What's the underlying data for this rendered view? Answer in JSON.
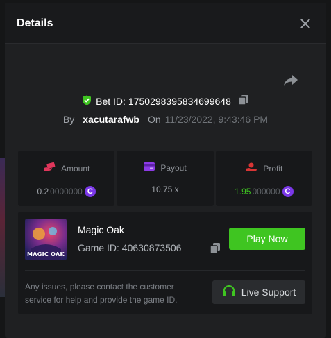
{
  "modal": {
    "title": "Details"
  },
  "bet": {
    "id_label": "Bet ID:",
    "id_value": "1750298395834699648",
    "by_label": "By",
    "username": "xacutarafwb",
    "on_label": "On",
    "date": "11/23/2022, 9:43:46 PM"
  },
  "stats": {
    "amount": {
      "label": "Amount",
      "value_main": "0.2",
      "value_dim": "0000000",
      "currency": "C"
    },
    "payout": {
      "label": "Payout",
      "value": "10.75 x"
    },
    "profit": {
      "label": "Profit",
      "value_main": "1.95",
      "value_dim": "000000",
      "currency": "C"
    }
  },
  "game": {
    "thumb_text": "MAGIC OAK",
    "name": "Magic Oak",
    "id_label": "Game ID: 40630873506",
    "play_label": "Play Now"
  },
  "support": {
    "help_text": "Any issues, please contact the customer service for help and provide the game ID.",
    "button_label": "Live Support"
  },
  "colors": {
    "accent_green": "#3fc521",
    "coin_purple": "#7b38e8",
    "verified_green": "#3fc521",
    "amount_icon": "#e0365b",
    "payout_icon": "#8d3be6",
    "profit_icon": "#d83535"
  },
  "icons": {
    "close": "close-icon",
    "share": "share-icon",
    "verified": "shield-check-icon",
    "copy": "copy-icon",
    "amount": "money-hand-icon",
    "payout": "wallet-card-icon",
    "profit": "profit-hand-icon",
    "support": "headset-icon"
  }
}
